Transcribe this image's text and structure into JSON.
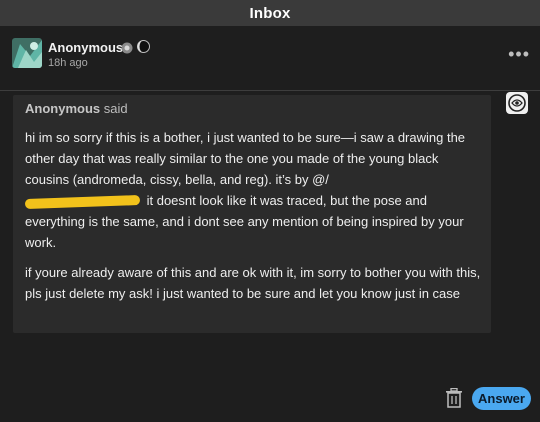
{
  "topbar": {
    "title": "Inbox"
  },
  "post": {
    "author": "Anonymous",
    "timestamp": "18h ago",
    "ask": {
      "asker_name": "Anonymous",
      "asker_suffix": " said",
      "paragraph1_before": "hi im so sorry if this is a bother, i just wanted to be sure—i saw a drawing the other day that was really similar to the one you made of the young black cousins (andromeda, cissy, bella, and reg). it’s by @/",
      "paragraph1_after": " it doesnt look like it was traced, but the pose and everything is the same, and i dont see any mention of being inspired by your work.",
      "paragraph2": "if youre already aware of this and are ok with it, im sorry to bother you with this, pls just delete my ask! i just wanted to be sure and let you know just in case"
    }
  },
  "actions": {
    "answer_label": "Answer"
  },
  "icons": [
    "more-options-icon",
    "trash-icon",
    "anon-badge-icon",
    "moon-badge-icon"
  ],
  "colors": {
    "background": "#1e1e1e",
    "topbar": "#3a3a3a",
    "ask_box": "#2b2b2b",
    "answer_button": "#4aa8f0",
    "redaction": "#f2c21b"
  }
}
